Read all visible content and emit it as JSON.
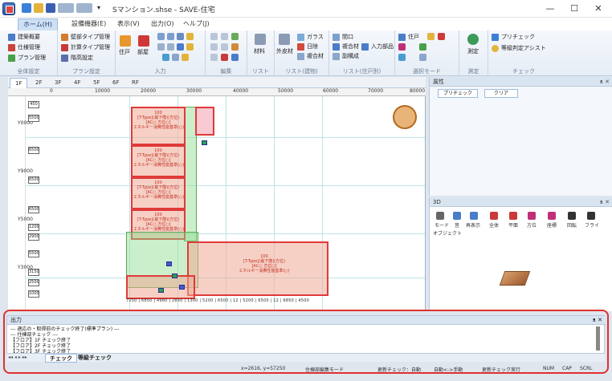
{
  "window": {
    "title": "Sマンション.shse - SAVE-住宅",
    "minimize": "—",
    "maximize": "☐",
    "close": "✕"
  },
  "menu_tabs": [
    "ホーム(H)",
    "設備機器(E)",
    "表示(V)",
    "出力(O)",
    "ヘルプ(J)"
  ],
  "ribbon": {
    "groups": [
      {
        "label": "全体設定",
        "items": [
          "建築概要",
          "仕様管理",
          "プラン管理"
        ]
      },
      {
        "label": "プラン設定",
        "items": [
          "壁部タイプ管理",
          "計算タイプ管理",
          "階高設定"
        ]
      },
      {
        "label": "入力",
        "items": [
          "住戸",
          "部屋"
        ]
      },
      {
        "label": "編集",
        "items": []
      },
      {
        "label": "リスト",
        "items": [
          "材料"
        ]
      },
      {
        "label": "リスト(建物)",
        "items": [
          "外皮材",
          "ガラス",
          "日除",
          "複合材"
        ]
      },
      {
        "label": "リスト(住戸別)",
        "items": [
          "間口",
          "複合材",
          "入力部品",
          "副構成"
        ]
      },
      {
        "label": "選択モード",
        "items": [
          "住戸"
        ]
      },
      {
        "label": "測定",
        "items": [
          "測定"
        ]
      },
      {
        "label": "チェック",
        "items": [
          "プリチェック",
          "等級判定アシスト"
        ]
      }
    ]
  },
  "floor_tabs": [
    "1F",
    "2F",
    "3F",
    "4F",
    "5F",
    "6F",
    "RF"
  ],
  "ruler_marks": [
    "0",
    "10000",
    "20000",
    "30000",
    "40000",
    "50000",
    "60000",
    "70000",
    "80000"
  ],
  "side_dims": [
    "450",
    "5500",
    "6500",
    "6500",
    "6500",
    "1200",
    "2900",
    "5500",
    "3150",
    "2500",
    "1000"
  ],
  "side_labels": [
    "Y0000",
    "Y9000",
    "Y5000",
    "Y3000"
  ],
  "plan_text": {
    "unit": "100",
    "type_line": "[T-Type](最下階)(方位)",
    "ac_line": "[AC○ 方位○]",
    "energy_line": "エネルギー消費性能基準(○)"
  },
  "bottom_dims": [
    "7250",
    "6850",
    "4980",
    "2850",
    "1300",
    "5200",
    "6500",
    "12",
    "5200",
    "6500",
    "12",
    "6850",
    "4500"
  ],
  "properties_panel": {
    "title": "属性",
    "buttons": [
      "プリチェック",
      "クリア"
    ]
  },
  "panel_3d": {
    "title": "3D",
    "tools": [
      "モード",
      "音",
      "再表示",
      "全体",
      "平面",
      "方位",
      "座標",
      "回転",
      "フライ"
    ],
    "object_label": "オブジェクト"
  },
  "output_panel": {
    "title": "出力",
    "lines": [
      "--- 適応の・取得前のチェック終了(標準プラン) ---",
      "--- 住棟部チェック ---",
      "【フロア】1F チェック終了",
      "【フロア】2F チェック終了",
      "【フロア】3F チェック終了"
    ],
    "tabs": [
      "チェック",
      "等級チェック"
    ]
  },
  "status_bar": {
    "coords": "x=2616, y=57250",
    "mode": "住棟部編集モード",
    "check": "更新チェック：自動",
    "auto": "自動<->手動",
    "run": "更新チェック実行",
    "num": "NUM",
    "cap": "CAP",
    "scrl": "SCRL"
  }
}
